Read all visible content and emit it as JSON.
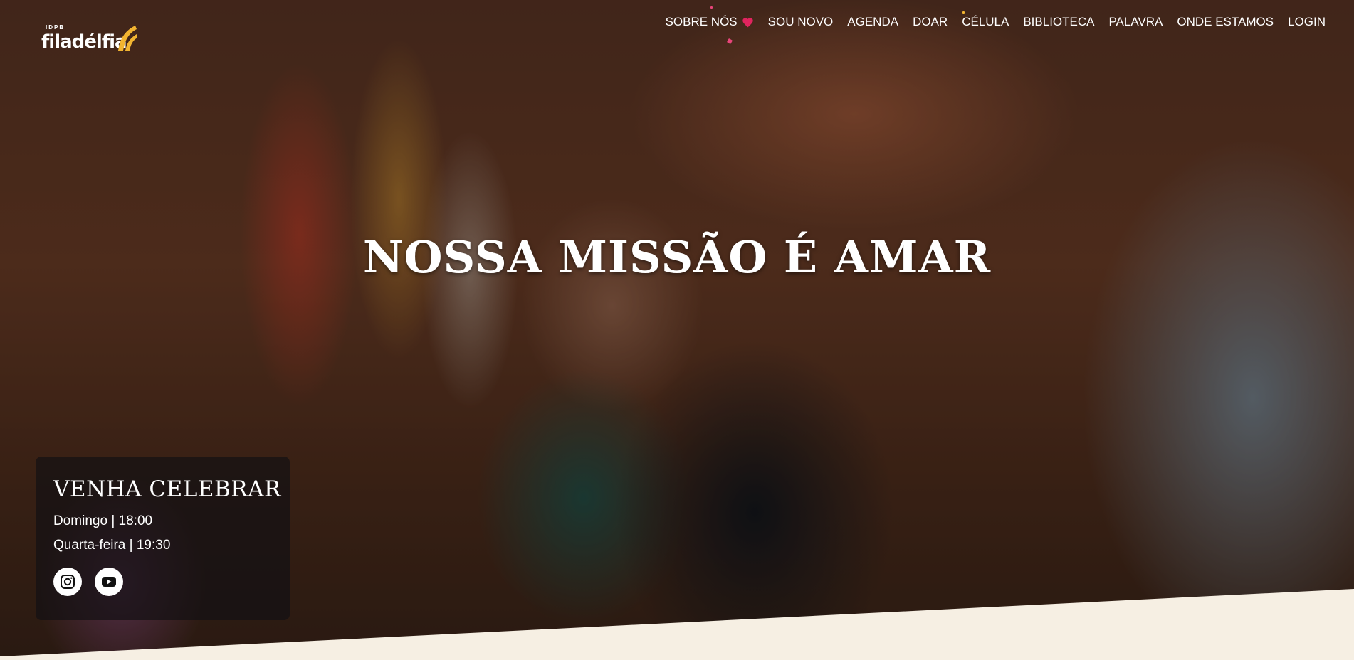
{
  "header": {
    "logo": {
      "pretitle": "IDPB",
      "wordmark": "filadélfia"
    },
    "nav": [
      {
        "label": "SOBRE NÓS",
        "icon": "heart-icon"
      },
      {
        "label": "SOU NOVO"
      },
      {
        "label": "AGENDA"
      },
      {
        "label": "DOAR"
      },
      {
        "label": "CÉLULA"
      },
      {
        "label": "BIBLIOTECA"
      },
      {
        "label": "PALAVRA"
      },
      {
        "label": "ONDE ESTAMOS"
      },
      {
        "label": "LOGIN"
      }
    ]
  },
  "hero": {
    "title": "NOSSA MISSÃO É AMAR"
  },
  "celebrate": {
    "title": "VENHA CELEBRAR",
    "schedule": [
      "Domingo | 18:00",
      "Quarta-feira | 19:30"
    ],
    "social": [
      {
        "icon": "instagram-icon"
      },
      {
        "icon": "youtube-icon"
      }
    ]
  },
  "colors": {
    "accent_logo": "#f2b431",
    "heart": "#e0245e",
    "footer_band": "#f6efe3"
  }
}
